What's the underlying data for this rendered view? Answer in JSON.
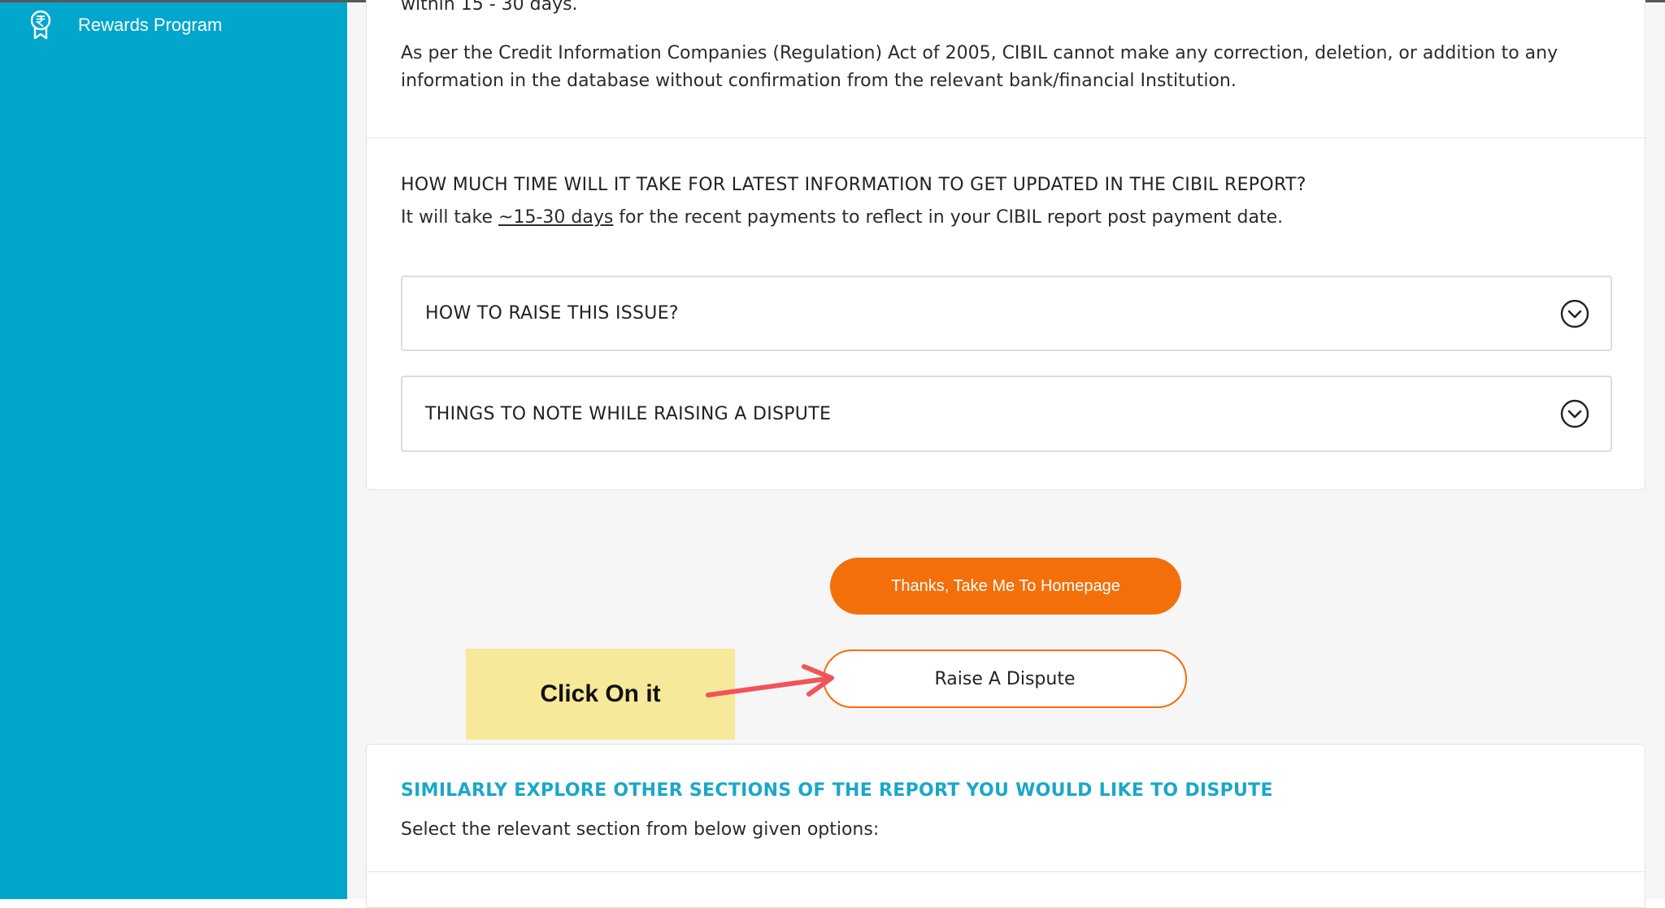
{
  "sidebar": {
    "items": [
      {
        "label": "Rewards Program",
        "icon": "rupee-badge-icon"
      }
    ],
    "color": "#00a6cc"
  },
  "content": {
    "para_top": "within 15 - 30 days.",
    "para_act_line1": "As per the Credit Information Companies (Regulation) Act of 2005, CIBIL cannot make any correction, deletion, or addition to any",
    "para_act_line2": "information in the database without confirmation from the relevant bank/financial Institution.",
    "faq_heading": "HOW MUCH TIME WILL IT TAKE FOR LATEST INFORMATION TO GET UPDATED IN THE CIBIL REPORT?",
    "faq_answer_prefix": "It will take ",
    "faq_answer_link": "~15-30 days",
    "faq_answer_suffix": " for the recent payments to reflect in your CIBIL report post payment date.",
    "accordions": [
      {
        "label": "HOW TO RAISE THIS ISSUE?",
        "icon": "chevron-down-circle-icon"
      },
      {
        "label": "THINGS TO NOTE WHILE RAISING A DISPUTE",
        "icon": "chevron-down-circle-icon"
      }
    ]
  },
  "actions": {
    "homepage_label": "Thanks, Take Me To Homepage",
    "dispute_label": "Raise A Dispute",
    "accent": "#f36f0a"
  },
  "annotation": {
    "callout_text": "Click On it",
    "callout_color": "#f7e99a",
    "arrow_color": "#f0545a"
  },
  "explore": {
    "title": "SIMILARLY EXPLORE OTHER SECTIONS OF THE REPORT YOU WOULD LIKE TO DISPUTE",
    "subtitle": "Select the relevant section from below given options:",
    "title_color": "#1aa7c9"
  }
}
